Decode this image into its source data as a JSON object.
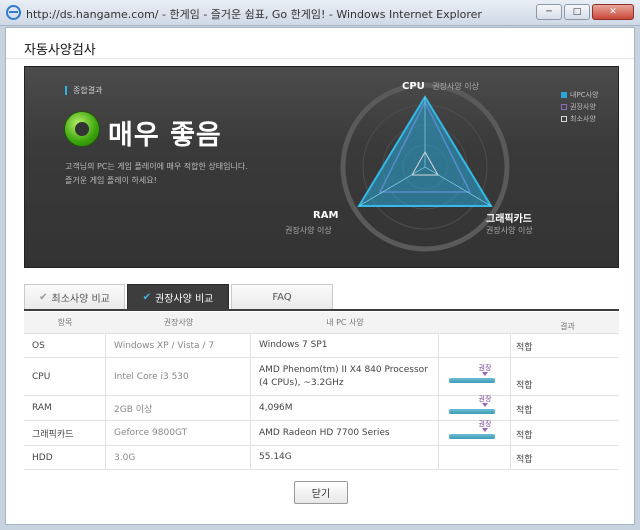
{
  "window": {
    "title": "http://ds.hangame.com/ - 한게임 - 즐거운 쉼표, Go 한게임! - Windows Internet Explorer",
    "btn_min": "─",
    "btn_max": "□",
    "btn_close": "✕"
  },
  "page": {
    "title": "자동사양검사"
  },
  "result": {
    "section_label": "종합결과",
    "verdict": "매우 좋음",
    "desc_line1": "고객님의 PC는 게임 플레이에 매우 적합한 상태입니다.",
    "desc_line2": "즐거운 게임 플레이 하세요!"
  },
  "radar": {
    "cpu": {
      "label": "CPU",
      "status": "권장사양 이상"
    },
    "ram": {
      "label": "RAM",
      "status": "권장사양 이상"
    },
    "gpu": {
      "label": "그래픽카드",
      "status": "권장사양 이상"
    },
    "colors": {
      "my_pc": "#2aa7d8",
      "recommended": "#8e6bbf",
      "minimum": "#d8d8d8"
    }
  },
  "legend": {
    "my_pc": "내PC사양",
    "recommended": "권장사양",
    "minimum": "최소사양"
  },
  "tabs": [
    {
      "label": "최소사양 비교"
    },
    {
      "label": "권장사양 비교"
    },
    {
      "label": "FAQ"
    }
  ],
  "table": {
    "headers": [
      "항목",
      "권장사양",
      "내 PC 사양",
      "",
      "결과"
    ],
    "rows": [
      {
        "item": "OS",
        "recommended": "Windows XP / Vista / 7",
        "mine": "Windows 7 SP1",
        "gauge": false,
        "result": "적합"
      },
      {
        "item": "CPU",
        "recommended": "Intel Core i3 530",
        "mine": "AMD Phenom(tm) II X4 840 Processor (4 CPUs), ~3.2GHz",
        "gauge": true,
        "gauge_mark": "권장",
        "result": "적합"
      },
      {
        "item": "RAM",
        "recommended": "2GB 이상",
        "mine": "4,096M",
        "gauge": true,
        "gauge_mark": "권장",
        "result": "적합"
      },
      {
        "item": "그래픽카드",
        "recommended": "Geforce 9800GT",
        "mine": "AMD Radeon HD 7700 Series",
        "gauge": true,
        "gauge_mark": "권장",
        "result": "적합"
      },
      {
        "item": "HDD",
        "recommended": "3.0G",
        "mine": "55.14G",
        "gauge": false,
        "result": "적합"
      }
    ]
  },
  "footer": {
    "close_label": "닫기"
  }
}
